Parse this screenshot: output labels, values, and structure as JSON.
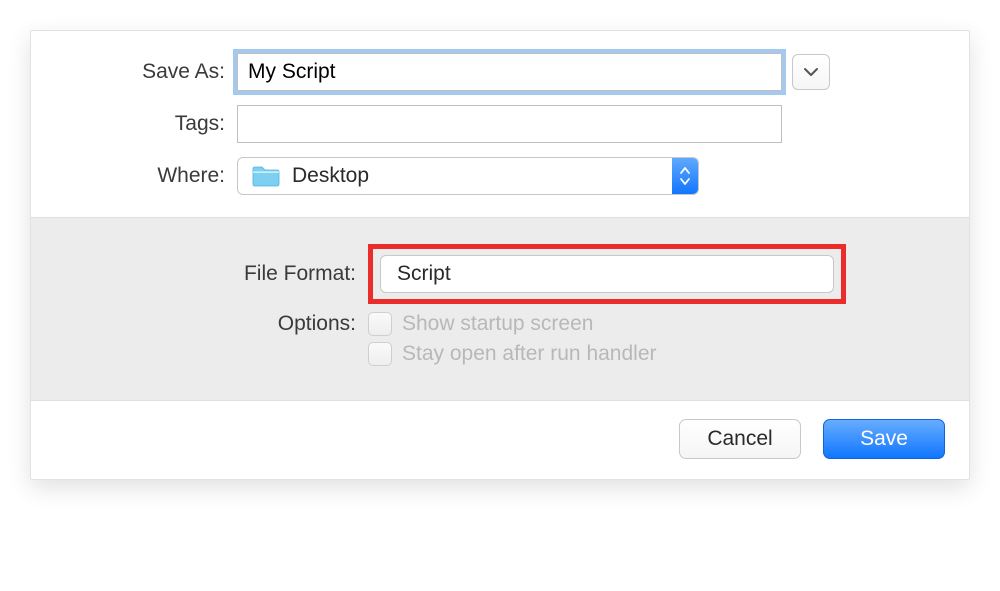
{
  "labels": {
    "saveAs": "Save As:",
    "tags": "Tags:",
    "where": "Where:",
    "fileFormat": "File Format:",
    "options": "Options:"
  },
  "saveAsValue": "My Script",
  "tagsValue": "",
  "whereValue": "Desktop",
  "fileFormatValue": "Script",
  "optionCheckboxes": {
    "showStartup": "Show startup screen",
    "stayOpen": "Stay open after run handler"
  },
  "buttons": {
    "cancel": "Cancel",
    "save": "Save"
  }
}
